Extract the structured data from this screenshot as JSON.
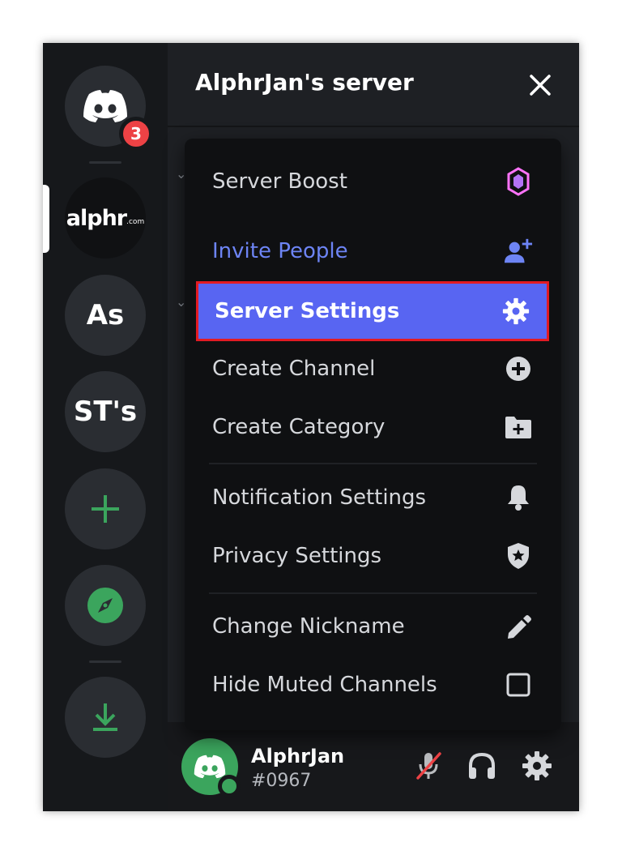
{
  "guilds": {
    "home_badge": "3",
    "items": [
      {
        "label": "As"
      },
      {
        "label": "ST's"
      }
    ],
    "alphr_logo": "alphr",
    "alphr_logo_suffix": ".com"
  },
  "header": {
    "server_name": "AlphrJan's server"
  },
  "menu": {
    "items": [
      {
        "label": "Server Boost",
        "icon": "boost-gem-icon"
      },
      {
        "label": "Invite People",
        "icon": "add-user-icon"
      },
      {
        "label": "Server Settings",
        "icon": "gear-icon"
      },
      {
        "label": "Create Channel",
        "icon": "plus-circle-icon"
      },
      {
        "label": "Create Category",
        "icon": "folder-plus-icon"
      },
      {
        "label": "Notification Settings",
        "icon": "bell-icon"
      },
      {
        "label": "Privacy Settings",
        "icon": "shield-star-icon"
      },
      {
        "label": "Change Nickname",
        "icon": "pencil-icon"
      },
      {
        "label": "Hide Muted Channels",
        "icon": "checkbox-icon"
      }
    ]
  },
  "user": {
    "name": "AlphrJan",
    "tag": "#0967"
  },
  "colors": {
    "accent": "#5865f2",
    "invite": "#6d84f4",
    "green": "#3ba55d",
    "red": "#ed4245",
    "boost": "#ff73fa"
  }
}
